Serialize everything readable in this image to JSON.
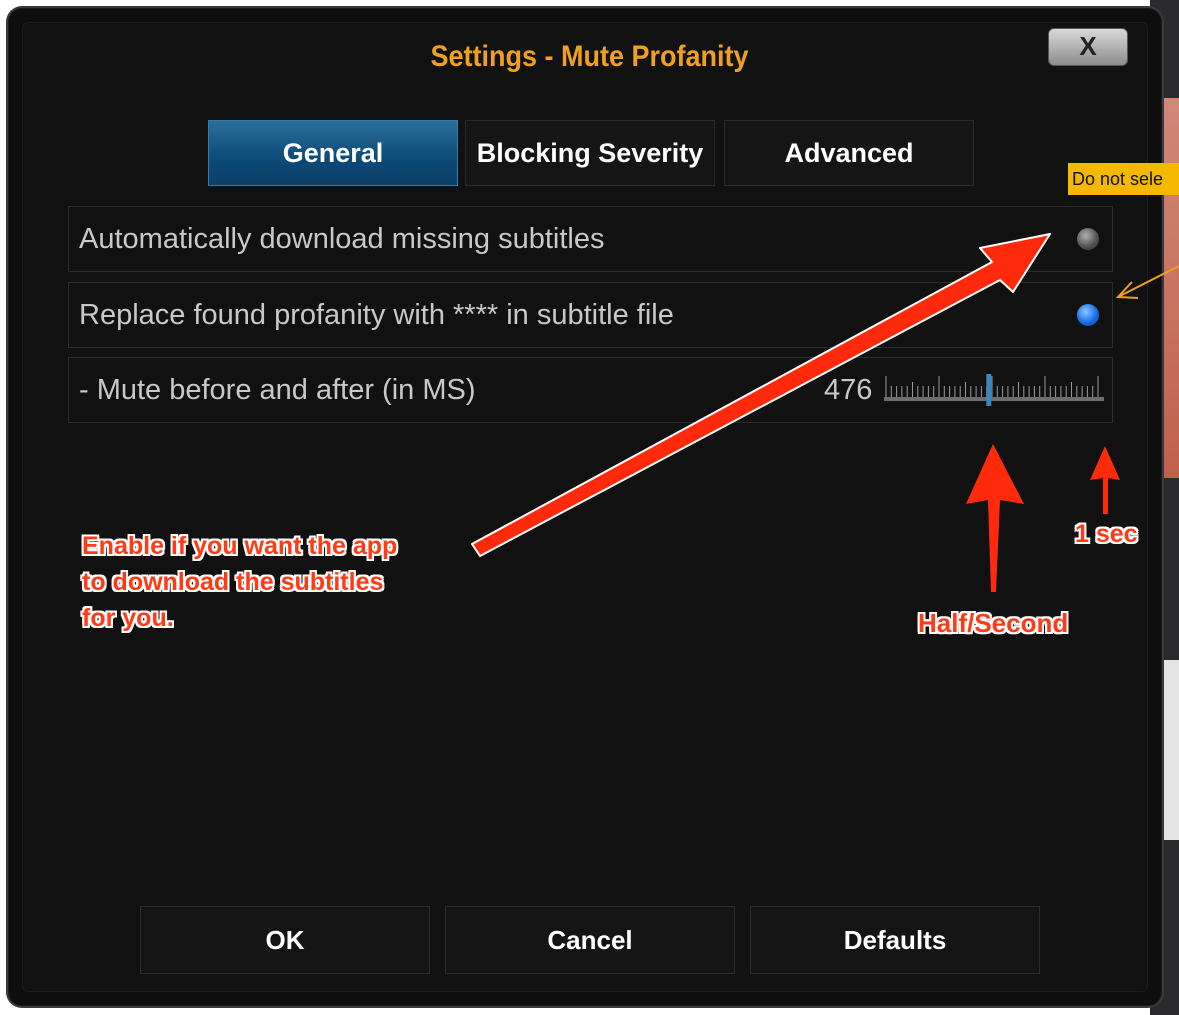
{
  "dialog": {
    "title": "Settings - Mute Profanity",
    "close_label": "X"
  },
  "tabs": [
    {
      "label": "General",
      "active": true
    },
    {
      "label": "Blocking Severity",
      "active": false
    },
    {
      "label": "Advanced",
      "active": false
    }
  ],
  "settings": [
    {
      "label": "Automatically download missing subtitles",
      "type": "radio",
      "enabled": false
    },
    {
      "label": "Replace found profanity with **** in subtitle file",
      "type": "radio",
      "enabled": true
    },
    {
      "label": "- Mute before and after (in MS)",
      "type": "slider",
      "value": "476",
      "fraction": 0.476
    }
  ],
  "buttons": {
    "ok": "OK",
    "cancel": "Cancel",
    "defaults": "Defaults"
  },
  "annotations": {
    "note": "Do not sele",
    "enable_text": [
      "Enable if you want the app",
      "to download the subtitles",
      "for you."
    ],
    "half_second": "Half/Second",
    "one_sec": "1 sec"
  },
  "colors": {
    "title": "#f0a020",
    "tab_active": "#0c4a78",
    "radio_on": "#1570e8",
    "annotation": "#ff3a16",
    "note_bg": "#f5b800"
  }
}
